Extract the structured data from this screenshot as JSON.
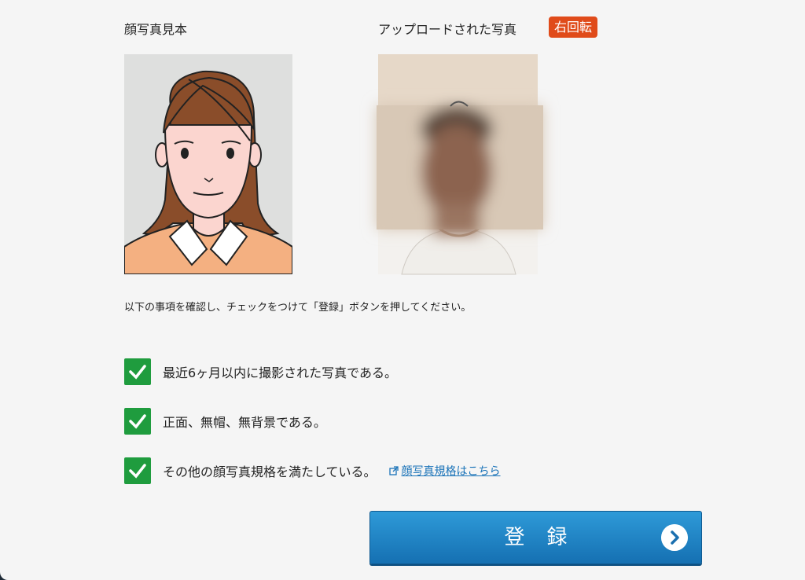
{
  "sample": {
    "title": "顔写真見本"
  },
  "uploaded": {
    "title": "アップロードされた写真",
    "rotate_label": "右回転"
  },
  "instruction": "以下の事項を確認し、チェックをつけて「登録」ボタンを押してください。",
  "checks": [
    {
      "label": "最近6ヶ月以内に撮影された写真である。",
      "checked": true
    },
    {
      "label": "正面、無帽、無背景である。",
      "checked": true
    },
    {
      "label": "その他の顔写真規格を満たしている。",
      "checked": true,
      "link": "顔写真規格はこちら"
    }
  ],
  "register_button": "登録",
  "colors": {
    "accent": "#1f9c3e",
    "button": "#1a7fc1",
    "badge": "#e04b1a",
    "link": "#1a73b8"
  }
}
